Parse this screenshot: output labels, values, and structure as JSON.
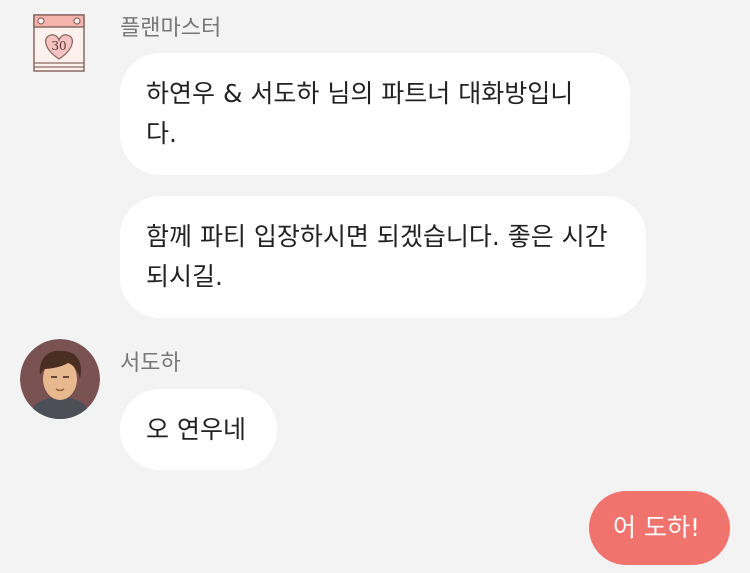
{
  "messages": [
    {
      "sender": "플랜마스터",
      "avatar_icon": "calendar-heart-icon",
      "avatar_number": "30",
      "bubbles": [
        "하연우 & 서도하 님의 파트너 대화방입니다.",
        "함께 파티 입장하시면 되겠습니다. 좋은 시간 되시길."
      ]
    },
    {
      "sender": "서도하",
      "avatar_icon": "profile-avatar-icon",
      "bubbles": [
        "오 연우네"
      ]
    }
  ],
  "my_message": "어 도하!",
  "colors": {
    "background": "#f3f3f3",
    "bubble_other": "#ffffff",
    "bubble_me": "#f0736d"
  }
}
